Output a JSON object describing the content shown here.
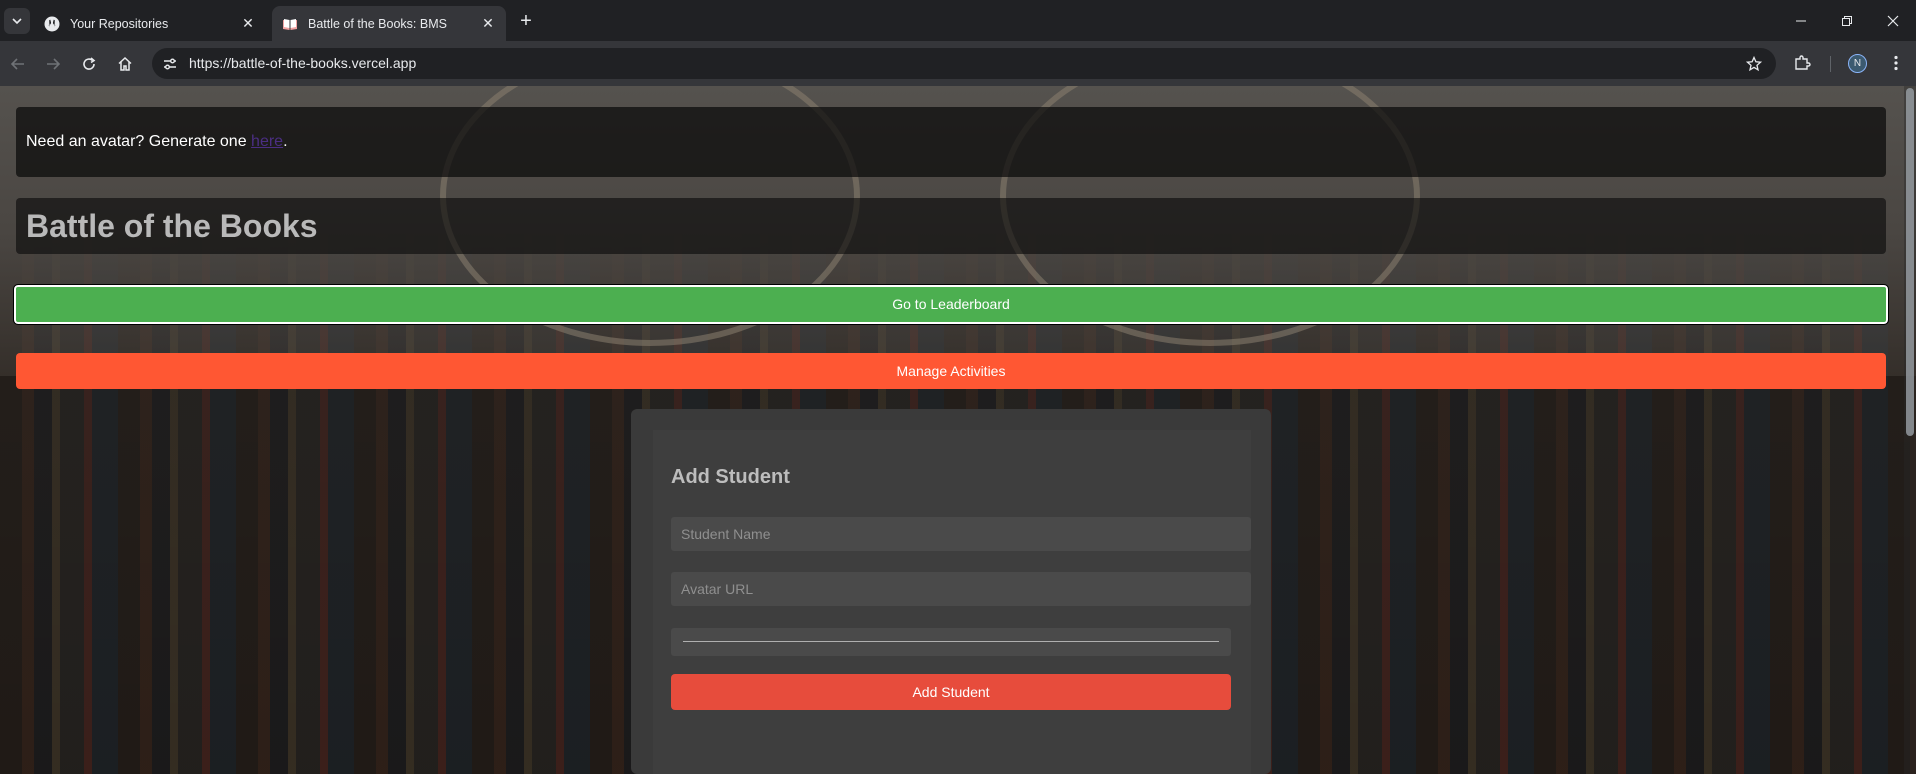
{
  "browser": {
    "tabs": [
      {
        "title": "Your Repositories",
        "icon": "github-icon",
        "active": false
      },
      {
        "title": "Battle of the Books: BMS",
        "icon": "book-icon",
        "active": true
      }
    ],
    "url": "https://battle-of-the-books.vercel.app",
    "profile_initial": "N"
  },
  "page": {
    "notice": {
      "text": "Need an avatar? Generate one ",
      "link_text": "here",
      "suffix": "."
    },
    "title": "Battle of the Books",
    "leaderboard_button": "Go to Leaderboard",
    "manage_button": "Manage Activities",
    "add_student": {
      "heading": "Add Student",
      "name_placeholder": "Student Name",
      "avatar_placeholder": "Avatar URL",
      "submit_label": "Add Student"
    }
  },
  "colors": {
    "leaderboard": "#4caf50",
    "manage": "#ff5733",
    "add_student": "#e74c3c"
  }
}
